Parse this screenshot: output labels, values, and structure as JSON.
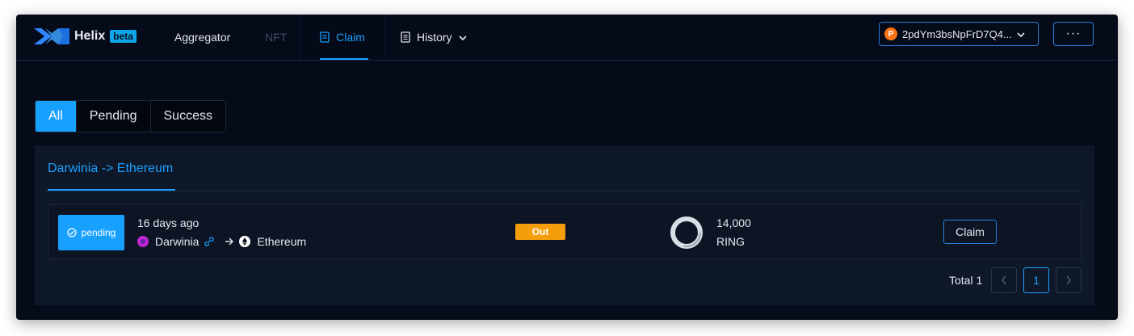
{
  "header": {
    "brand": "Helix",
    "beta": "beta",
    "nav": {
      "aggregator": "Aggregator",
      "nft": "NFT",
      "claim": "Claim",
      "history": "History"
    },
    "account": "2pdYm3bsNpFrD7Q4...",
    "more": "···"
  },
  "filters": [
    "All",
    "Pending",
    "Success"
  ],
  "panel": {
    "tab": "Darwinia -> Ethereum",
    "rows": [
      {
        "status": "pending",
        "time": "16 days ago",
        "from": "Darwinia",
        "to": "Ethereum",
        "direction": "Out",
        "amount": "14,000",
        "symbol": "RING",
        "action": "Claim"
      }
    ],
    "pagination": {
      "total": "Total 1",
      "current": "1"
    }
  },
  "colors": {
    "accent": "#18a0ff",
    "background": "#050b19",
    "panel": "#0f1829",
    "out": "#f59e0b"
  }
}
